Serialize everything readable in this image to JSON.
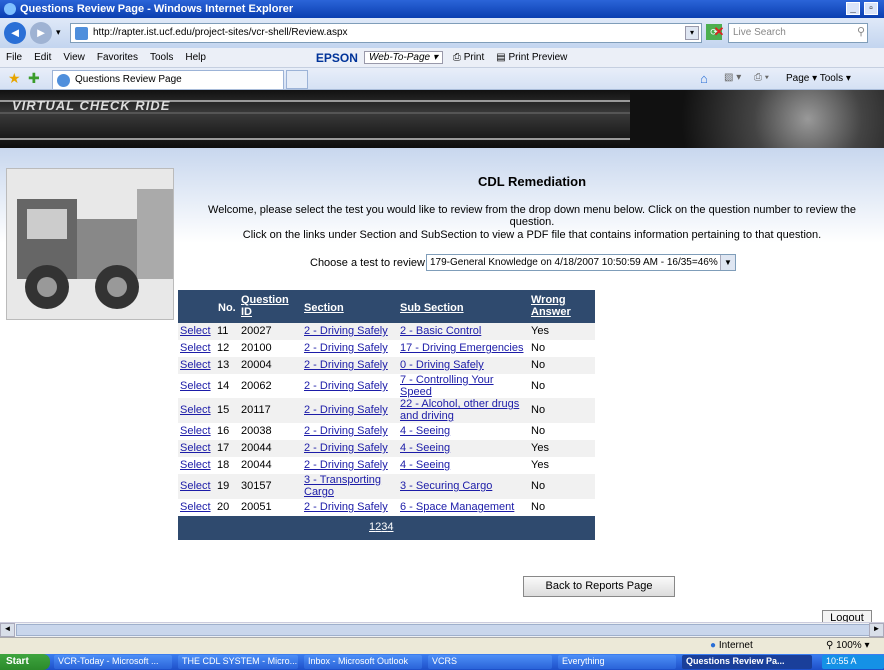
{
  "window": {
    "title": "Questions Review Page - Windows Internet Explorer"
  },
  "browser": {
    "address": "http://rapter.ist.ucf.edu/project-sites/vcr-shell/Review.aspx",
    "search_placeholder": "Live Search",
    "menu": [
      "File",
      "Edit",
      "View",
      "Favorites",
      "Tools",
      "Help"
    ],
    "epson": "EPSON",
    "web_to_page": "Web-To-Page",
    "print": "Print",
    "print_preview": "Print Preview",
    "tab_title": "Questions Review Page",
    "right_tools": "Page  ▾  Tools ▾"
  },
  "banner": {
    "title": "VIRTUAL CHECK RIDE"
  },
  "page": {
    "heading": "CDL Remediation",
    "intro1": "Welcome, please select the test you would like to review from the drop down menu below. Click on the question number to review the",
    "intro2": "question.",
    "intro3": "Click on the links under Section and SubSection to view a PDF file that contains information pertaining to that question.",
    "choose_label": "Choose a test to review:",
    "selected_test": "179-General Knowledge on 4/18/2007 10:50:59 AM - 16/35=46%",
    "back_button": "Back to Reports Page",
    "logout_button": "Logout"
  },
  "table": {
    "headers": {
      "no": "No.",
      "qid1": "Question",
      "qid2": "ID",
      "section": "Section",
      "sub": "Sub Section",
      "wrong1": "Wrong",
      "wrong2": "Answer"
    },
    "rows": [
      {
        "select": "Select",
        "no": "11",
        "qid": "20027",
        "section": "2 - Driving Safely",
        "sub1": "2 - Basic Control",
        "sub2": "",
        "wrong": "Yes"
      },
      {
        "select": "Select",
        "no": "12",
        "qid": "20100",
        "section": "2 - Driving Safely",
        "sub1": "17 - Driving Emergencies",
        "sub2": "",
        "wrong": "No"
      },
      {
        "select": "Select",
        "no": "13",
        "qid": "20004",
        "section": "2 - Driving Safely",
        "sub1": "0 - Driving Safely",
        "sub2": "",
        "wrong": "No"
      },
      {
        "select": "Select",
        "no": "14",
        "qid": "20062",
        "section": "2 - Driving Safely",
        "sub1": "7 - Controlling Your",
        "sub2": "Speed",
        "wrong": "No"
      },
      {
        "select": "Select",
        "no": "15",
        "qid": "20117",
        "section": "2 - Driving Safely",
        "sub1": "22 - Alcohol, other drugs",
        "sub2": "and driving",
        "wrong": "No"
      },
      {
        "select": "Select",
        "no": "16",
        "qid": "20038",
        "section": "2 - Driving Safely",
        "sub1": "4 - Seeing",
        "sub2": "",
        "wrong": "No"
      },
      {
        "select": "Select",
        "no": "17",
        "qid": "20044",
        "section": "2 - Driving Safely",
        "sub1": "4 - Seeing",
        "sub2": "",
        "wrong": "Yes"
      },
      {
        "select": "Select",
        "no": "18",
        "qid": "20044",
        "section": "2 - Driving Safely",
        "sub1": "4 - Seeing",
        "sub2": "",
        "wrong": "Yes"
      },
      {
        "select": "Select",
        "no": "19",
        "qid": "30157",
        "section": "3 - Transporting",
        "section2": "Cargo",
        "sub1": "3 - Securing Cargo",
        "sub2": "",
        "wrong": "No"
      },
      {
        "select": "Select",
        "no": "20",
        "qid": "20051",
        "section": "2 - Driving Safely",
        "sub1": "6 - Space Management",
        "sub2": "",
        "wrong": "No"
      }
    ],
    "pages": [
      "1",
      "2",
      "3",
      "4"
    ]
  },
  "status": {
    "zone": "Internet",
    "zoom": "100%"
  },
  "taskbar": {
    "start": "Start",
    "items": [
      "VCR-Today - Microsoft ...",
      "THE CDL SYSTEM - Micro...",
      "Inbox - Microsoft Outlook",
      "VCRS",
      "Everything",
      "Questions Review Pa..."
    ],
    "clock": "10:55 A"
  }
}
